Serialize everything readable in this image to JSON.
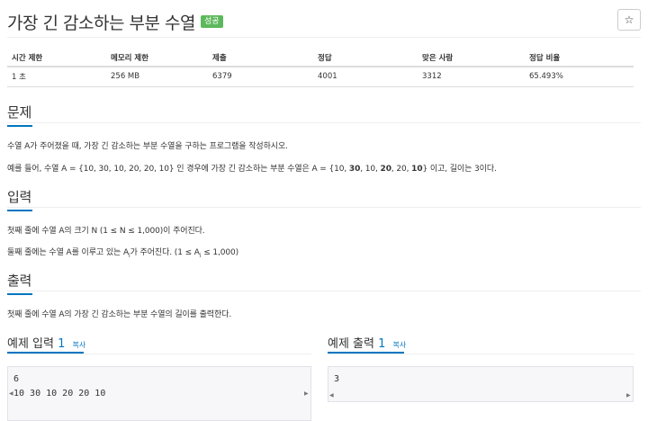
{
  "problem": {
    "title": "가장 긴 감소하는 부분 수열",
    "badge": "성공",
    "star_icon": "☆"
  },
  "info_table": {
    "headers": [
      "시간 제한",
      "메모리 제한",
      "제출",
      "정답",
      "맞은 사람",
      "정답 비율"
    ],
    "values": [
      "1 초",
      "256 MB",
      "6379",
      "4001",
      "3312",
      "65.493%"
    ]
  },
  "sections": {
    "problem_heading": "문제",
    "problem_line1": "수열 A가 주어졌을 때, 가장 긴 감소하는 부분 수열을 구하는 프로그램을 작성하시오.",
    "problem_line2": {
      "prefix": "예를 들어, 수열 A = {10, 30, 10, 20, 20, 10} 인 경우에 가장 긴 감소하는 부분 수열은 A = {10, ",
      "bold1": "30",
      "mid1": ", 10, ",
      "bold2": "20",
      "mid2": ", 20, ",
      "bold3": "10",
      "suffix": "}  이고, 길이는 3이다."
    },
    "input_heading": "입력",
    "input_line1": "첫째 줄에 수열 A의 크기 N (1 ≤ N ≤ 1,000)이 주어진다.",
    "input_line2": {
      "prefix": "둘째 줄에는 수열 A를 이루고 있는 A",
      "sub": "i",
      "suffix": "가 주어진다. (1 ≤ A",
      "sub2": "i",
      "suffix2": " ≤ 1,000)"
    },
    "output_heading": "출력",
    "output_line1": "첫째 줄에 수열 A의 가장 긴 감소하는 부분 수열의 길이를 출력한다."
  },
  "samples": {
    "input": {
      "label": "예제 입력",
      "number": "1",
      "copy": "복사",
      "content": "6\n10 30 10 20 20 10"
    },
    "output": {
      "label": "예제 출력",
      "number": "1",
      "copy": "복사",
      "content": "3"
    }
  },
  "colors": {
    "accent": "#0076c0",
    "badge": "#5cb85c"
  }
}
